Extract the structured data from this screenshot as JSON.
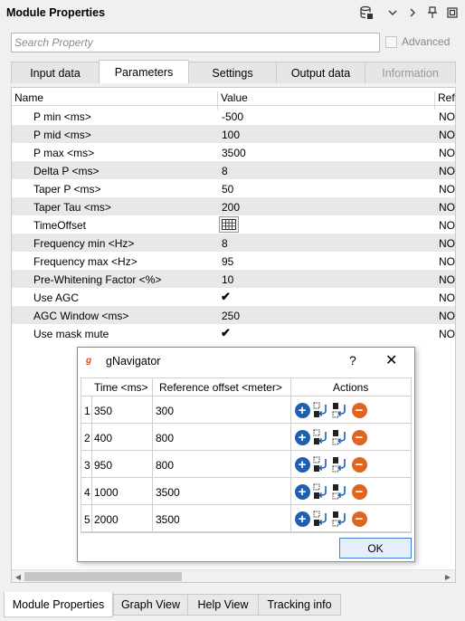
{
  "window": {
    "title": "Module Properties",
    "icons": [
      "database-icon",
      "chevron-down-icon",
      "chevron-right-icon",
      "pin-icon",
      "restore-icon"
    ]
  },
  "search": {
    "placeholder": "Search Property",
    "value": ""
  },
  "advanced": {
    "label": "Advanced",
    "checked": false
  },
  "tabs": [
    {
      "label": "Input data",
      "active": false
    },
    {
      "label": "Parameters",
      "active": true
    },
    {
      "label": "Settings",
      "active": false
    },
    {
      "label": "Output data",
      "active": false
    },
    {
      "label": "Information",
      "active": false,
      "disabled": true
    }
  ],
  "grid": {
    "columns": [
      "Name",
      "Value",
      "Refe"
    ],
    "rows": [
      {
        "name": "P min <ms>",
        "value": "-500",
        "ref": "NO"
      },
      {
        "name": "P mid <ms>",
        "value": "100",
        "ref": "NO"
      },
      {
        "name": "P max <ms>",
        "value": "3500",
        "ref": "NO"
      },
      {
        "name": "Delta P <ms>",
        "value": "8",
        "ref": "NO"
      },
      {
        "name": "Taper P <ms>",
        "value": "50",
        "ref": "NO"
      },
      {
        "name": "Taper Tau <ms>",
        "value": "200",
        "ref": "NO"
      },
      {
        "name": "TimeOffset",
        "value": "",
        "ref": "NO",
        "widget": "table-icon"
      },
      {
        "name": "Frequency min <Hz>",
        "value": "8",
        "ref": "NO"
      },
      {
        "name": "Frequency max <Hz>",
        "value": "95",
        "ref": "NO"
      },
      {
        "name": "Pre-Whitening Factor <%>",
        "value": "10",
        "ref": "NO"
      },
      {
        "name": "Use AGC",
        "value": "",
        "ref": "NO",
        "widget": "checkbox",
        "checked": true
      },
      {
        "name": "AGC Window <ms>",
        "value": "250",
        "ref": "NO"
      },
      {
        "name": "Use mask mute",
        "value": "",
        "ref": "NO",
        "widget": "checkbox",
        "checked": true
      }
    ]
  },
  "bottom_tabs": [
    {
      "label": "Module Properties",
      "active": true
    },
    {
      "label": "Graph View",
      "active": false
    },
    {
      "label": "Help View",
      "active": false
    },
    {
      "label": "Tracking info",
      "active": false
    }
  ],
  "dialog": {
    "title": "gNavigator",
    "logo": "g",
    "help": "?",
    "close": "✕",
    "columns": [
      "Time <ms>",
      "Reference offset <meter>",
      "Actions"
    ],
    "rows": [
      {
        "index": "1",
        "time": "350",
        "offset": "300"
      },
      {
        "index": "2",
        "time": "400",
        "offset": "800"
      },
      {
        "index": "3",
        "time": "950",
        "offset": "800"
      },
      {
        "index": "4",
        "time": "1000",
        "offset": "3500"
      },
      {
        "index": "5",
        "time": "2000",
        "offset": "3500"
      }
    ],
    "actions": [
      "add-icon",
      "insert-above-icon",
      "insert-below-icon",
      "remove-icon"
    ],
    "ok_label": "OK"
  }
}
